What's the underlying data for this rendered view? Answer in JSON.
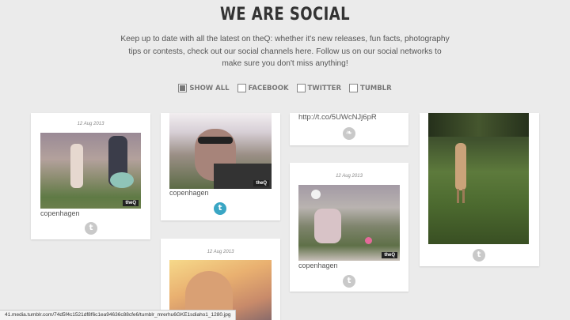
{
  "header": {
    "title": "WE ARE SOCIAL",
    "intro": "Keep up to date with all the latest on theQ: whether it's new releases, fun facts, photography tips or contests, check out our social channels here. Follow us on our social networks to make sure you don't miss anything!"
  },
  "filters": [
    {
      "label": "SHOW ALL",
      "checked": true
    },
    {
      "label": "FACEBOOK",
      "checked": false
    },
    {
      "label": "TWITTER",
      "checked": false
    },
    {
      "label": "TUMBLR",
      "checked": false
    }
  ],
  "posts": {
    "p1": {
      "date": "12 Aug 2013",
      "caption": "copenhagen",
      "network_icon": "tumblr-icon",
      "badge": "theQ"
    },
    "p2": {
      "caption": "copenhagen",
      "network_icon": "tumblr-icon",
      "badge": "theQ"
    },
    "p3": {
      "date": "12 Aug 2013"
    },
    "p4": {
      "url": "http://t.co/5UWcNJj6pR",
      "network_icon": "twitter-icon"
    },
    "p5": {
      "date": "12 Aug 2013",
      "caption": "copenhagen",
      "network_icon": "tumblr-icon",
      "badge": "theQ"
    },
    "p6": {
      "network_icon": "tumblr-icon"
    }
  },
  "icons": {
    "tumblr": "t",
    "twitter": "❧"
  },
  "colors": {
    "background": "#ebebeb",
    "tumblr_active": "#3aa6c4",
    "icon_inactive": "#c9c9c9"
  },
  "status_bar": {
    "url": "41.media.tumblr.com/74d5f4c1521df8f6c1ea94636c88cfe6/tumblr_mrerhu6GKE1sdiaho1_1280.jpg"
  }
}
